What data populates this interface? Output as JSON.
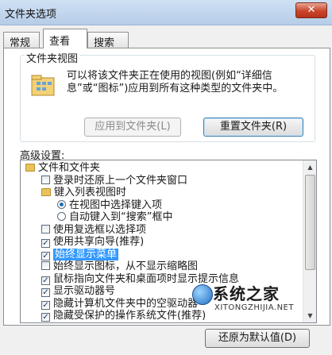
{
  "window": {
    "title": "文件夹选项",
    "close_label": "✕"
  },
  "tabs": [
    {
      "label": "常规",
      "active": false
    },
    {
      "label": "查看",
      "active": true
    },
    {
      "label": "搜索",
      "active": false
    }
  ],
  "folder_views": {
    "label": "文件夹视图",
    "description": "可以将该文件夹正在使用的视图(例如“详细信息”或“图标”)应用到所有这种类型的文件夹中。",
    "apply_button": "应用到文件夹(L)",
    "reset_button": "重置文件夹(R)"
  },
  "advanced": {
    "label": "高级设置:",
    "items": [
      {
        "type": "folder",
        "label": "文件和文件夹",
        "level": 0
      },
      {
        "type": "checkbox",
        "label": "登录时还原上一个文件夹窗口",
        "checked": false,
        "level": 1
      },
      {
        "type": "folder",
        "label": "键入列表视图时",
        "level": 1
      },
      {
        "type": "radio",
        "label": "在视图中选择键入项",
        "checked": true,
        "level": 2
      },
      {
        "type": "radio",
        "label": "自动键入到“搜索”框中",
        "checked": false,
        "level": 2
      },
      {
        "type": "checkbox",
        "label": "使用复选框以选择项",
        "checked": false,
        "level": 1
      },
      {
        "type": "checkbox",
        "label": "使用共享向导(推荐)",
        "checked": true,
        "level": 1
      },
      {
        "type": "checkbox",
        "label": "始终显示菜单",
        "checked": true,
        "level": 1,
        "selected": true
      },
      {
        "type": "checkbox",
        "label": "始终显示图标，从不显示缩略图",
        "checked": false,
        "level": 1
      },
      {
        "type": "checkbox",
        "label": "鼠标指向文件夹和桌面项时显示提示信息",
        "checked": true,
        "level": 1
      },
      {
        "type": "checkbox",
        "label": "显示驱动器号",
        "checked": true,
        "level": 1
      },
      {
        "type": "checkbox",
        "label": "隐藏计算机文件夹中的空驱动器",
        "checked": true,
        "level": 1
      },
      {
        "type": "checkbox",
        "label": "隐藏受保护的操作系统文件(推荐)",
        "checked": true,
        "level": 1
      }
    ]
  },
  "restore_button": "还原为默认值(D)",
  "watermark": {
    "cn": "系统之家",
    "en": "XITONGZHIJIA.NET"
  },
  "colors": {
    "selection": "#3399ff",
    "titlebar": "#b6cde8",
    "close": "#c9452c"
  }
}
